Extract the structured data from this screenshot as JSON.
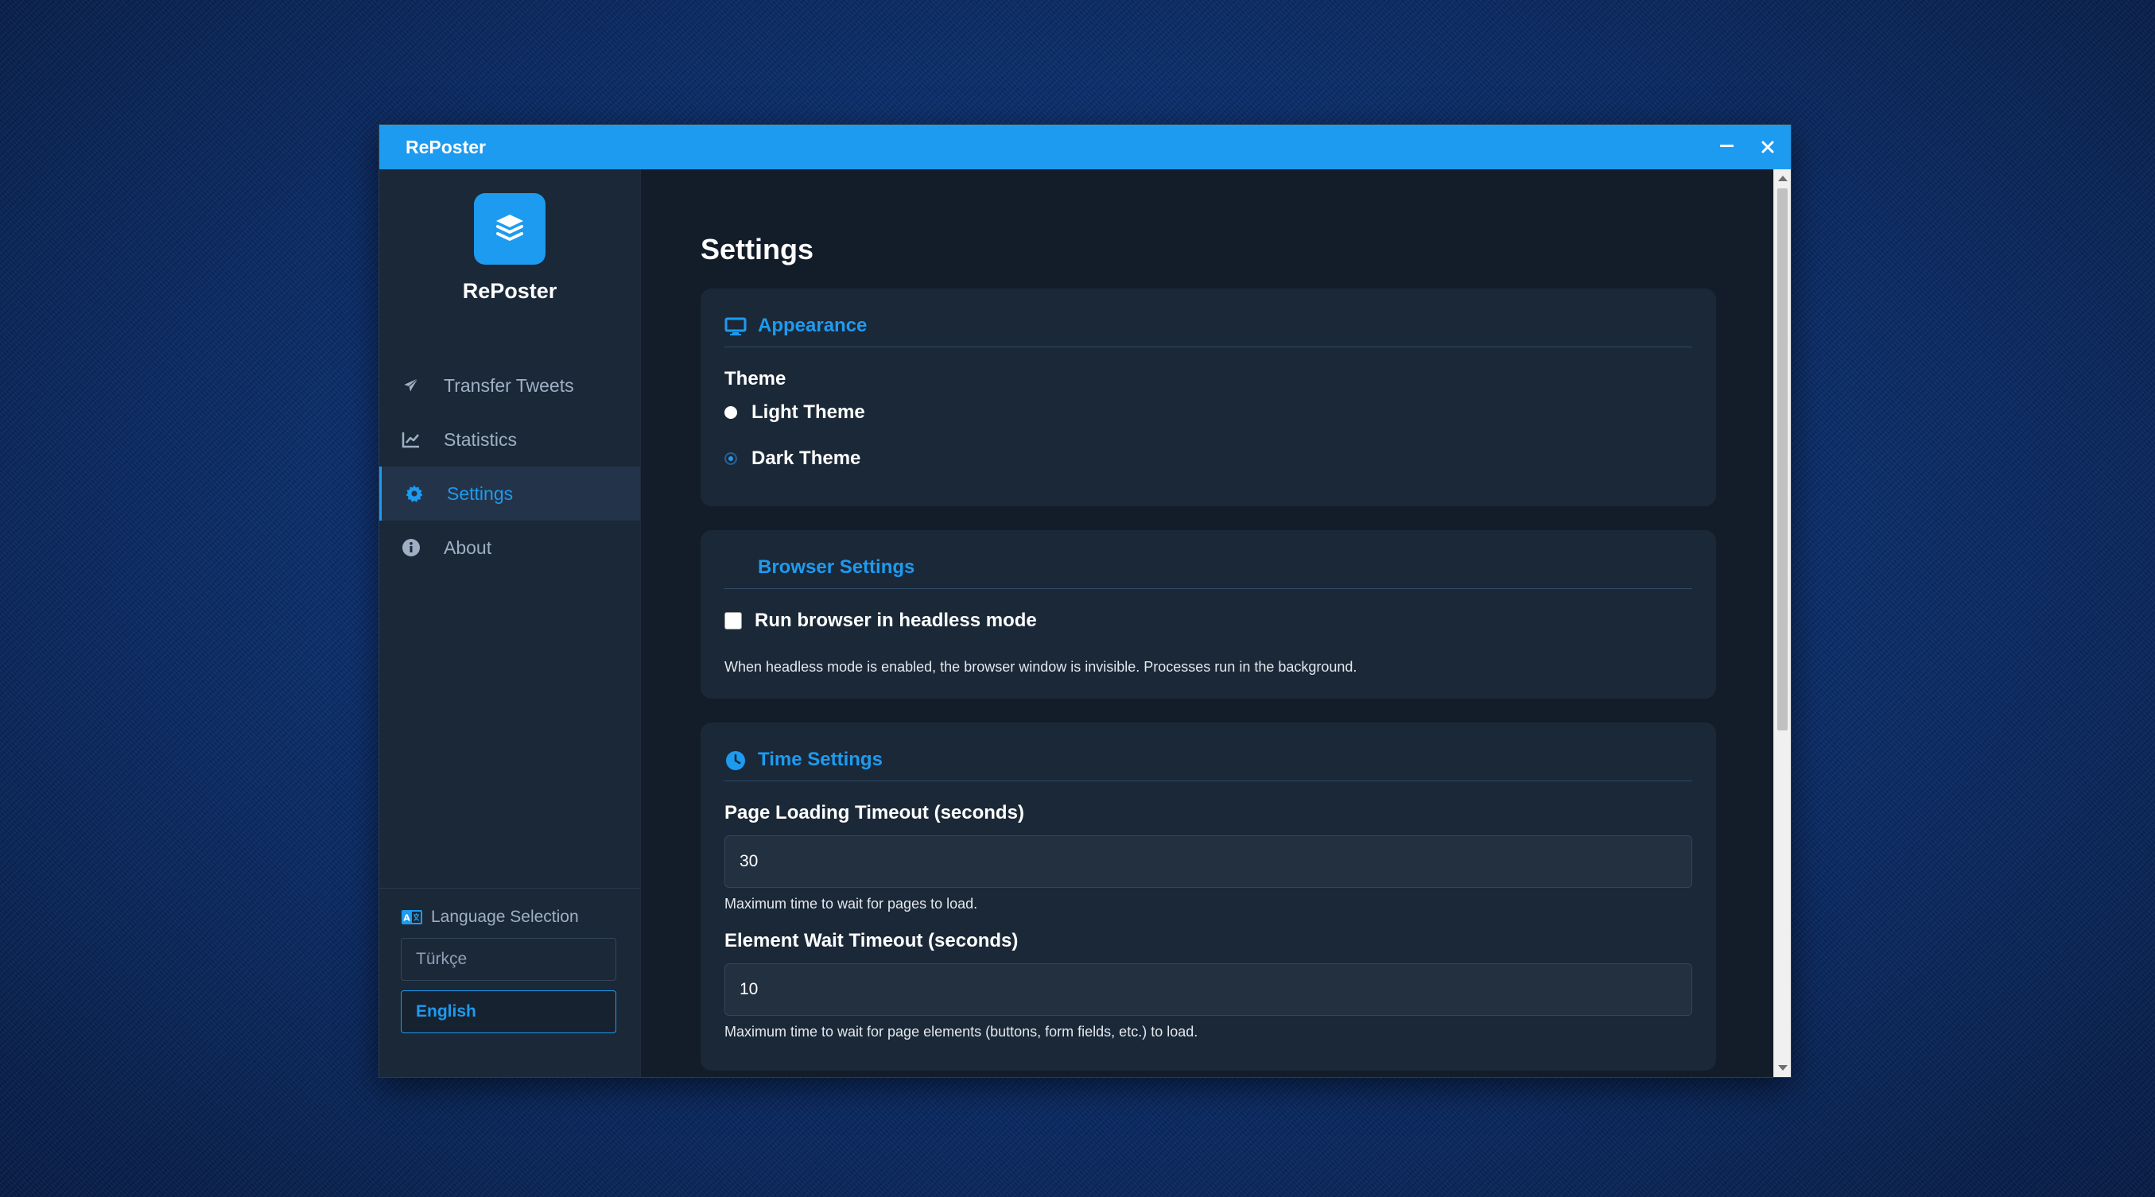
{
  "window": {
    "title": "RePoster"
  },
  "sidebar": {
    "brand": "RePoster",
    "items": [
      {
        "label": "Transfer Tweets",
        "icon": "paper-plane-icon"
      },
      {
        "label": "Statistics",
        "icon": "line-chart-icon"
      },
      {
        "label": "Settings",
        "icon": "gear-icon",
        "active": true
      },
      {
        "label": "About",
        "icon": "info-icon"
      }
    ],
    "language": {
      "heading": "Language Selection",
      "options": [
        "Türkçe",
        "English"
      ],
      "selected": "English"
    }
  },
  "main": {
    "page_title": "Settings",
    "appearance": {
      "heading": "Appearance",
      "theme_label": "Theme",
      "options": [
        "Light Theme",
        "Dark Theme"
      ],
      "selected": "Dark Theme"
    },
    "browser": {
      "heading": "Browser Settings",
      "headless_label": "Run browser in headless mode",
      "headless_checked": false,
      "help": "When headless mode is enabled, the browser window is invisible. Processes run in the background."
    },
    "time": {
      "heading": "Time Settings",
      "page_timeout_label": "Page Loading Timeout (seconds)",
      "page_timeout_value": "30",
      "page_timeout_help": "Maximum time to wait for pages to load.",
      "element_timeout_label": "Element Wait Timeout (seconds)",
      "element_timeout_value": "10",
      "element_timeout_help": "Maximum time to wait for page elements (buttons, form fields, etc.) to load."
    }
  },
  "colors": {
    "accent": "#1d9bf0",
    "sidebar_bg": "#1b2837",
    "main_bg": "#131d29",
    "card_bg": "#1b2837"
  }
}
